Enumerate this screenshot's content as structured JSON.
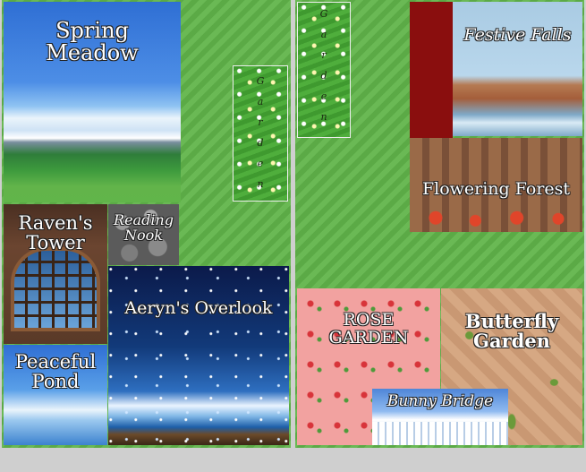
{
  "left_panel": {
    "spring_meadow": "Spring\nMeadow",
    "garden_vertical": [
      "G",
      "a",
      "r",
      "d",
      "e",
      "n"
    ],
    "ravens_tower": "Raven's\nTower",
    "reading_nook": "Reading\nNook",
    "aeryns_overlook": "Aeryn's Overlook",
    "peaceful_pond": "Peaceful\nPond"
  },
  "right_panel": {
    "garden_vertical": [
      "G",
      "a",
      "r",
      "d",
      "e",
      "n"
    ],
    "festive_falls": "Festive Falls",
    "flowering_forest": "Flowering Forest",
    "rose_garden": "ROSE\nGARDEN",
    "butterfly_garden": "Butterfly\nGarden",
    "bunny_bridge": "Bunny Bridge"
  }
}
